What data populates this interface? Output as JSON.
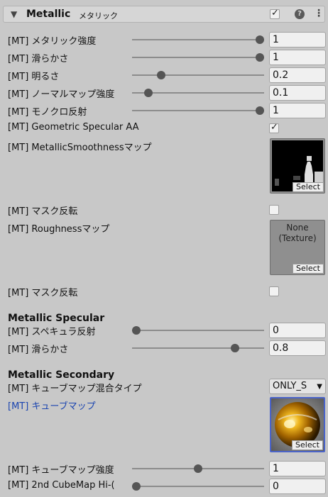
{
  "header": {
    "title": "Metallic",
    "subtitle": "メタリック",
    "enabled": true
  },
  "rows": {
    "metallic": {
      "label": "[MT] メタリック強度",
      "value": "1",
      "fraction": 1.0
    },
    "smoothness": {
      "label": "[MT] 滑らかさ",
      "value": "1",
      "fraction": 1.0
    },
    "brightness": {
      "label": "[MT] 明るさ",
      "value": "0.2",
      "fraction": 0.2
    },
    "normal_strength": {
      "label": "[MT] ノーマルマップ強度",
      "value": "0.1",
      "fraction": 0.1
    },
    "mono_reflect": {
      "label": "[MT] モノクロ反射",
      "value": "1",
      "fraction": 1.0
    },
    "geometric_aa": {
      "label": "[MT] Geometric Specular AA",
      "checked": true
    },
    "ms_map": {
      "label": "[MT] MetallicSmoothnessマップ",
      "select_label": "Select"
    },
    "mask_invert_1": {
      "label": "[MT] マスク反転",
      "checked": false
    },
    "roughness_map": {
      "label": "[MT] Roughnessマップ",
      "none_label": "None\n(Texture)",
      "select_label": "Select"
    },
    "mask_invert_2": {
      "label": "[MT] マスク反転",
      "checked": false
    }
  },
  "specular": {
    "title": "Metallic Specular",
    "reflect": {
      "label": "[MT] スペキュラ反射",
      "value": "0",
      "fraction": 0.0
    },
    "smooth": {
      "label": "[MT] 滑らかさ",
      "value": "0.8",
      "fraction": 0.8
    }
  },
  "secondary": {
    "title": "Metallic Secondary",
    "blend_type": {
      "label": "[MT] キューブマップ混合タイプ",
      "value": "ONLY_S"
    },
    "cubemap": {
      "label": "[MT] キューブマップ",
      "select_label": "Select"
    },
    "cubemap_strength": {
      "label": "[MT] キューブマップ強度",
      "value": "1",
      "fraction": 0.5
    },
    "hi_cut": {
      "label": "[MT] 2nd CubeMap Hi-(",
      "value": "0",
      "fraction": 0.0
    }
  },
  "colors": {
    "accent_border": "#4a63c9",
    "label_blue": "#1a44b0"
  }
}
